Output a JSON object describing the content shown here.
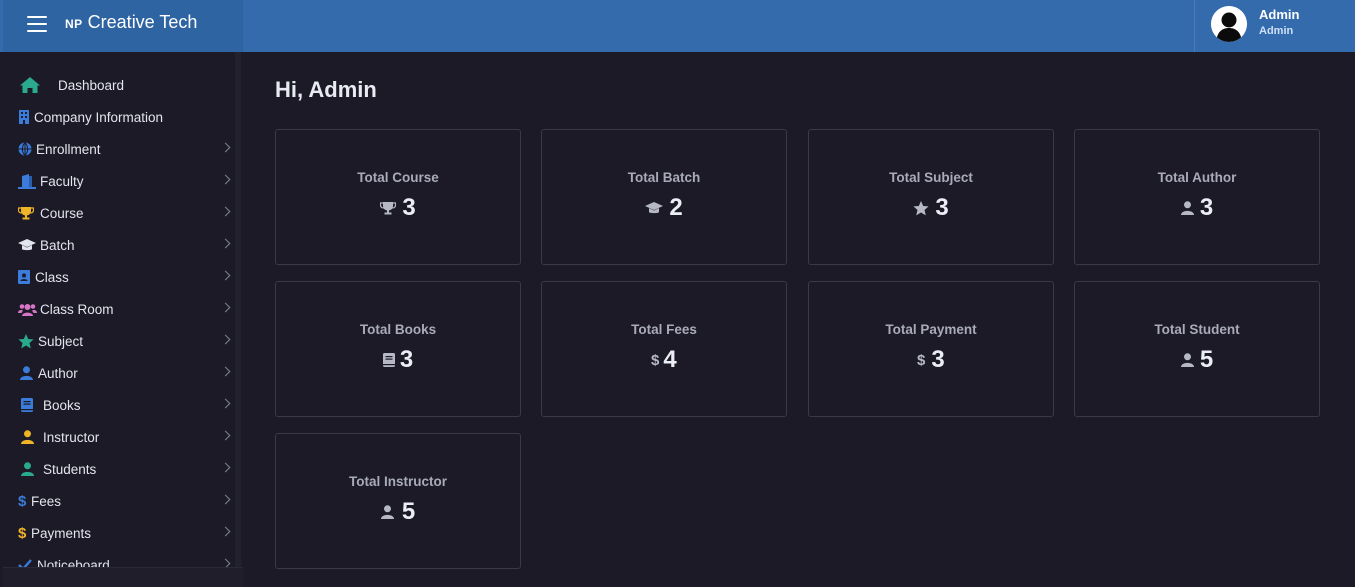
{
  "header": {
    "brand_prefix": "NP",
    "brand_name": "Creative Tech",
    "user_name": "Admin",
    "user_role": "Admin"
  },
  "colors": {
    "topbar": "#336bad",
    "background": "#1b1a26",
    "accent_teal": "#2aa98f",
    "accent_blue": "#3b7bd9",
    "accent_gold": "#f0b429",
    "accent_pink": "#d974c8"
  },
  "sidebar": {
    "items": [
      {
        "label": "Dashboard",
        "icon": "home-icon",
        "has_submenu": false
      },
      {
        "label": "Company Information",
        "icon": "building-icon",
        "has_submenu": false
      },
      {
        "label": "Enrollment",
        "icon": "globe-icon",
        "has_submenu": true
      },
      {
        "label": "Faculty",
        "icon": "door-icon",
        "has_submenu": true
      },
      {
        "label": "Course",
        "icon": "trophy-icon",
        "has_submenu": true
      },
      {
        "label": "Batch",
        "icon": "graduation-cap-icon",
        "has_submenu": true
      },
      {
        "label": "Class",
        "icon": "address-card-icon",
        "has_submenu": true
      },
      {
        "label": "Class Room",
        "icon": "users-icon",
        "has_submenu": true
      },
      {
        "label": "Subject",
        "icon": "star-icon",
        "has_submenu": true
      },
      {
        "label": "Author",
        "icon": "user-icon",
        "has_submenu": true
      },
      {
        "label": "Books",
        "icon": "book-icon",
        "has_submenu": true
      },
      {
        "label": "Instructor",
        "icon": "user-icon",
        "has_submenu": true
      },
      {
        "label": "Students",
        "icon": "user-icon",
        "has_submenu": true
      },
      {
        "label": "Fees",
        "icon": "dollar-icon",
        "has_submenu": true
      },
      {
        "label": "Payments",
        "icon": "dollar-icon",
        "has_submenu": true
      },
      {
        "label": "Noticeboard",
        "icon": "check-icon",
        "has_submenu": true
      }
    ]
  },
  "main": {
    "greeting": "Hi, Admin",
    "cards": [
      {
        "title": "Total Course",
        "value": "3",
        "icon": "trophy-icon"
      },
      {
        "title": "Total Batch",
        "value": "2",
        "icon": "graduation-cap-icon"
      },
      {
        "title": "Total Subject",
        "value": "3",
        "icon": "star-icon"
      },
      {
        "title": "Total Author",
        "value": "3",
        "icon": "user-icon"
      },
      {
        "title": "Total Books",
        "value": "3",
        "icon": "book-icon"
      },
      {
        "title": "Total Fees",
        "value": "4",
        "icon": "dollar-icon"
      },
      {
        "title": "Total Payment",
        "value": "3",
        "icon": "dollar-icon"
      },
      {
        "title": "Total Student",
        "value": "5",
        "icon": "user-icon"
      },
      {
        "title": "Total Instructor",
        "value": "5",
        "icon": "user-icon"
      }
    ]
  }
}
